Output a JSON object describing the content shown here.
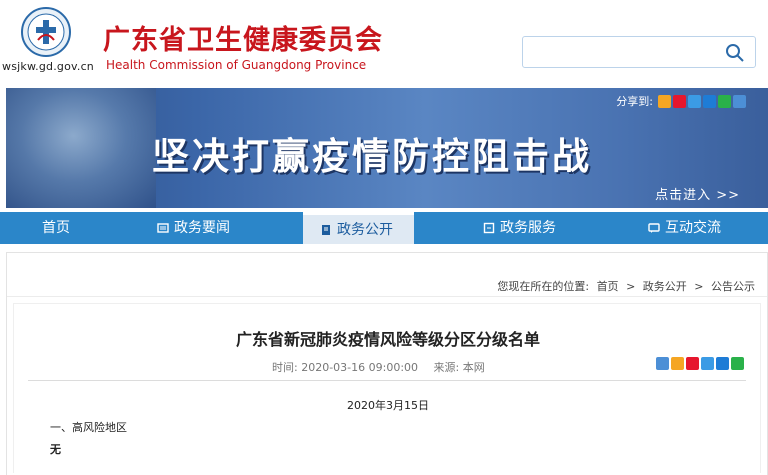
{
  "header": {
    "domain": "wsjkw.gd.gov.cn",
    "org_cn": "广东省卫生健康委员会",
    "org_en": "Health Commission of Guangdong Province",
    "search_placeholder": ""
  },
  "banner": {
    "share_label": "分享到:",
    "title": "坚决打赢疫情防控阻击战",
    "enter": "点击进入 >>"
  },
  "nav": {
    "items": [
      {
        "label": "首页",
        "icon": "none"
      },
      {
        "label": "政务要闻",
        "icon": "news-icon"
      },
      {
        "label": "政务公开",
        "icon": "doc-icon",
        "active": true
      },
      {
        "label": "政务服务",
        "icon": "service-icon"
      },
      {
        "label": "互动交流",
        "icon": "chat-icon"
      }
    ]
  },
  "breadcrumb": {
    "prefix": "您现在所在的位置:",
    "items": [
      "首页",
      "政务公开",
      "公告公示"
    ],
    "separator": ">"
  },
  "article": {
    "title": "广东省新冠肺炎疫情风险等级分区分级名单",
    "time": "时间: 2020-03-16 09:00:00",
    "source": "来源: 本网",
    "date": "2020年3月15日",
    "para1": "一、高风险地区",
    "para2": "无"
  },
  "colors": {
    "brand_red": "#c8161d",
    "nav_blue": "#2b86c9",
    "nav_active_bg": "#dfe9f3"
  }
}
